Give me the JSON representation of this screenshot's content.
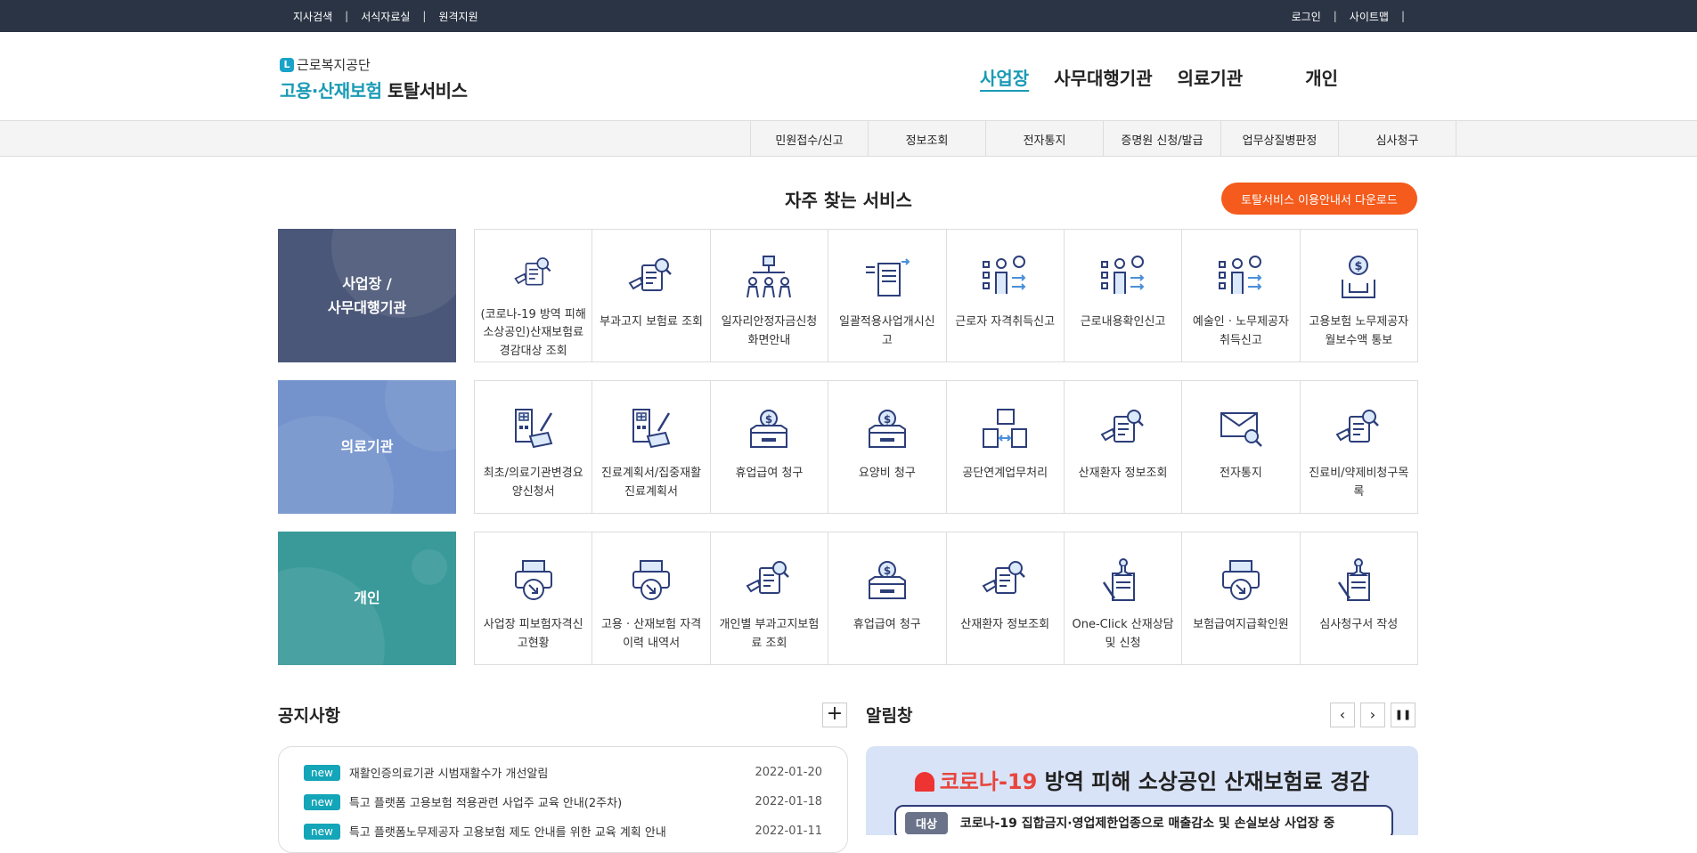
{
  "topbar": {
    "left_links": [
      "지사검색",
      "서식자료실",
      "원격지원"
    ],
    "right_links": [
      "로그인",
      "사이트맵"
    ],
    "separator": "|"
  },
  "logo": {
    "org_mark": "L",
    "org": "근로복지공단",
    "svc_part1": "고용·산재보험",
    "svc_part2": "토탈서비스"
  },
  "gnb": [
    "사업장",
    "사무대행기관",
    "의료기관",
    "개인"
  ],
  "subnav": [
    "민원접수/신고",
    "정보조회",
    "전자통지",
    "증명원 신청/발급",
    "업무상질병판정",
    "심사청구"
  ],
  "frequent": {
    "title": "자주 찾는 서비스",
    "download_label": "토탈서비스 이용안내서 다운로드"
  },
  "rows": [
    {
      "category_line1": "사업장 /",
      "category_line2": "사무대행기관",
      "color": "#4b5779",
      "items": [
        {
          "label": "(코로나-19 방역 피해 소상공인)산재보험료 경감대상 조회",
          "icon": "document-search"
        },
        {
          "label": "부과고지 보험료 조회",
          "icon": "document-search"
        },
        {
          "label": "일자리안정자금신청화면안내",
          "icon": "org-chart"
        },
        {
          "label": "일괄적용사업개시신고",
          "icon": "document-transfer"
        },
        {
          "label": "근로자 자격취득신고",
          "icon": "person-list"
        },
        {
          "label": "근로내용확인신고",
          "icon": "person-list"
        },
        {
          "label": "예술인 · 노무제공자 취득신고",
          "icon": "person-list"
        },
        {
          "label": "고용보험 노무제공자 월보수액 통보",
          "icon": "money-hand"
        }
      ]
    },
    {
      "category_line1": "의료기관",
      "category_line2": "",
      "color": "#7493cd",
      "items": [
        {
          "label": "최초/의료기관변경요양신청서",
          "icon": "hospital-document"
        },
        {
          "label": "진료계획서/집중재활진료계획서",
          "icon": "hospital-document"
        },
        {
          "label": "휴업급여 청구",
          "icon": "money-box"
        },
        {
          "label": "요양비 청구",
          "icon": "money-box"
        },
        {
          "label": "공단연계업무처리",
          "icon": "folder-exchange"
        },
        {
          "label": "산재환자 정보조회",
          "icon": "document-search"
        },
        {
          "label": "전자통지",
          "icon": "mail-search"
        },
        {
          "label": "진료비/약제비청구목록",
          "icon": "document-search"
        }
      ]
    },
    {
      "category_line1": "개인",
      "category_line2": "",
      "color": "#3a9a9a",
      "items": [
        {
          "label": "사업장 피보험자격신고현황",
          "icon": "printer-download"
        },
        {
          "label": "고용 · 산재보험 자격 이력 내역서",
          "icon": "printer-download"
        },
        {
          "label": "개인별 부과고지보험료 조회",
          "icon": "document-search"
        },
        {
          "label": "휴업급여 청구",
          "icon": "money-box"
        },
        {
          "label": "산재환자 정보조회",
          "icon": "document-search"
        },
        {
          "label": "One-Click 산재상담 및 신청",
          "icon": "stamp-document"
        },
        {
          "label": "보험급여지급확인원",
          "icon": "printer-download"
        },
        {
          "label": "심사청구서 작성",
          "icon": "stamp-document"
        }
      ]
    }
  ],
  "notice": {
    "title": "공지사항",
    "more": "+",
    "items": [
      {
        "badge": "new",
        "title": "재활인증의료기관 시범재활수가 개선알림",
        "date": "2022-01-20"
      },
      {
        "badge": "new",
        "title": "특고 플랫폼 고용보험 적용관련 사업주 교육 안내(2주차)",
        "date": "2022-01-18"
      },
      {
        "badge": "new",
        "title": "특고 플랫폼노무제공자 고용보험 제도 안내를 위한 교육 계획 안내",
        "date": "2022-01-11"
      }
    ]
  },
  "alert": {
    "title": "알림창",
    "prev": "‹",
    "next": "›",
    "pause": "❚❚",
    "banner_red": "코로나-19",
    "banner_rest": " 방역 피해 소상공인 산재보험료 경감",
    "target_tag": "대상",
    "target_text": "코로나-19 집합금지·영업제한업종으로 매출감소 및 손실보상 사업장 중"
  }
}
